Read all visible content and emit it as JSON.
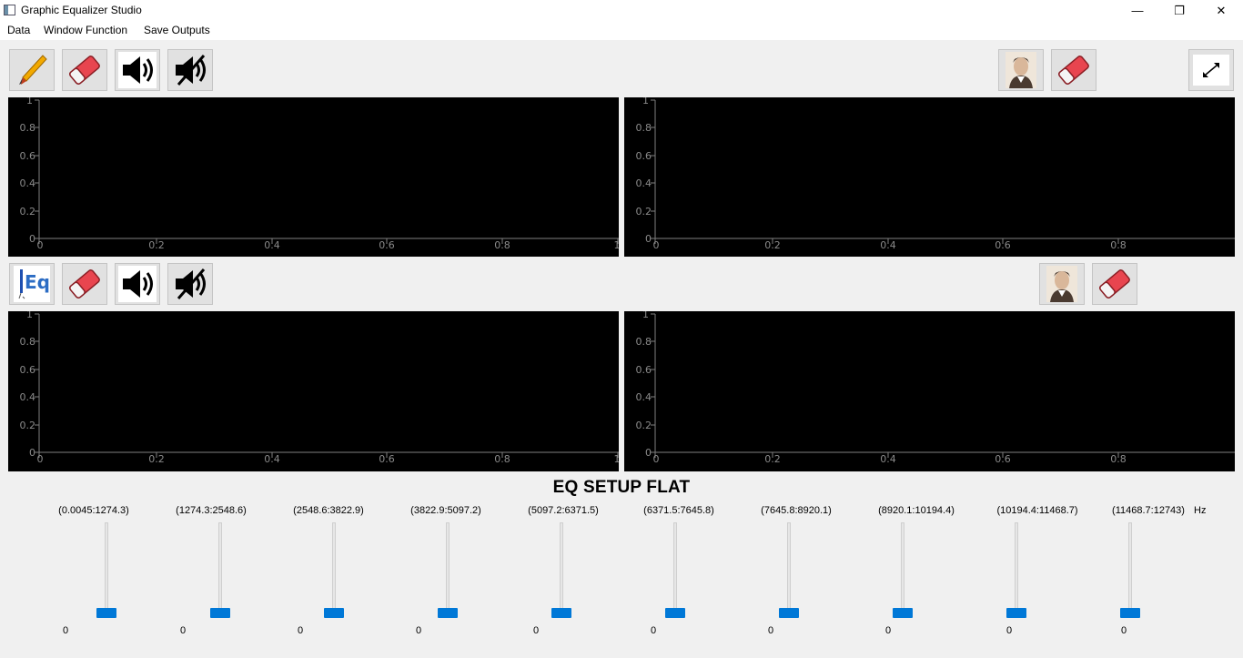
{
  "window": {
    "title": "Graphic Equalizer Studio",
    "controls": {
      "minimize": "—",
      "restore": "❐",
      "close": "✕"
    }
  },
  "menu": [
    "Data",
    "Window Function",
    "Save Outputs"
  ],
  "toolbar_top_left": [
    {
      "name": "brush-icon",
      "label": "draw"
    },
    {
      "name": "eraser-icon",
      "label": "clear"
    },
    {
      "name": "speaker-icon",
      "label": "play"
    },
    {
      "name": "mute-icon",
      "label": "stop"
    }
  ],
  "toolbar_top_right": [
    {
      "name": "fourier-portrait-icon"
    },
    {
      "name": "eraser-icon"
    },
    {
      "name": "expand-icon"
    }
  ],
  "toolbar_mid_left": [
    {
      "name": "eq-icon",
      "text": "Eq"
    },
    {
      "name": "eraser-icon"
    },
    {
      "name": "speaker-icon"
    },
    {
      "name": "mute-icon"
    }
  ],
  "toolbar_mid_right": [
    {
      "name": "fourier-portrait-icon"
    },
    {
      "name": "eraser-icon"
    }
  ],
  "plots": {
    "x_ticks": [
      "0",
      "0.2",
      "0.4",
      "0.6",
      "0.8",
      "1"
    ],
    "y_ticks": [
      "0",
      "0.2",
      "0.4",
      "0.6",
      "0.8",
      "1"
    ],
    "background": "#000000",
    "axis_color": "#7f7f7f"
  },
  "eq": {
    "title": "EQ SETUP FLAT",
    "unit": "Hz",
    "bands": [
      {
        "range": "(0.0045:1274.3)",
        "value": "0"
      },
      {
        "range": "(1274.3:2548.6)",
        "value": "0"
      },
      {
        "range": "(2548.6:3822.9)",
        "value": "0"
      },
      {
        "range": "(3822.9:5097.2)",
        "value": "0"
      },
      {
        "range": "(5097.2:6371.5)",
        "value": "0"
      },
      {
        "range": "(6371.5:7645.8)",
        "value": "0"
      },
      {
        "range": "(7645.8:8920.1)",
        "value": "0"
      },
      {
        "range": "(8920.1:10194.4)",
        "value": "0"
      },
      {
        "range": "(10194.4:11468.7)",
        "value": "0"
      },
      {
        "range": "(11468.7:12743)",
        "value": "0"
      }
    ],
    "accent": "#0078d7"
  }
}
